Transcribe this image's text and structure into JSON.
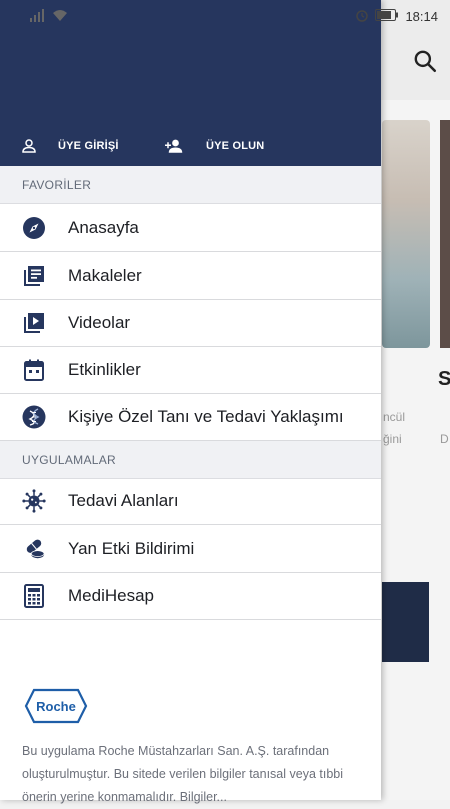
{
  "status_bar": {
    "time": "18:14",
    "icons": [
      "signal-icon",
      "wifi-icon",
      "alarm-icon",
      "battery-icon"
    ]
  },
  "background": {
    "partial_title_letter": "S",
    "partial_text_1": "ncül",
    "partial_text_2": "ğini",
    "partial_text_3": "D"
  },
  "drawer": {
    "header": {
      "login_label": "ÜYE GİRİŞİ",
      "signup_label": "ÜYE OLUN"
    },
    "sections": {
      "favorites_title": "FAVORİLER",
      "apps_title": "UYGULAMALAR"
    },
    "favorites": [
      {
        "label": "Anasayfa",
        "icon": "compass-icon"
      },
      {
        "label": "Makaleler",
        "icon": "articles-icon"
      },
      {
        "label": "Videolar",
        "icon": "video-library-icon"
      },
      {
        "label": "Etkinlikler",
        "icon": "calendar-icon"
      },
      {
        "label": "Kişiye Özel Tanı ve Tedavi Yaklaşımı",
        "icon": "dna-icon"
      }
    ],
    "apps": [
      {
        "label": "Tedavi Alanları",
        "icon": "virus-icon"
      },
      {
        "label": "Yan Etki Bildirimi",
        "icon": "pills-icon"
      },
      {
        "label": "MediHesap",
        "icon": "calculator-icon"
      }
    ],
    "footer": {
      "logo_text": "Roche",
      "disclaimer": "Bu uygulama Roche Müstahzarları San. A.Ş. tarafından oluşturulmuştur. Bu sitede verilen bilgiler tanısal veya tıbbi önerin yerine konmamalıdır. Bilgiler..."
    }
  },
  "colors": {
    "header_bg": "#26365e",
    "section_bg": "#f0f1f4",
    "icon_color": "#26365e"
  }
}
